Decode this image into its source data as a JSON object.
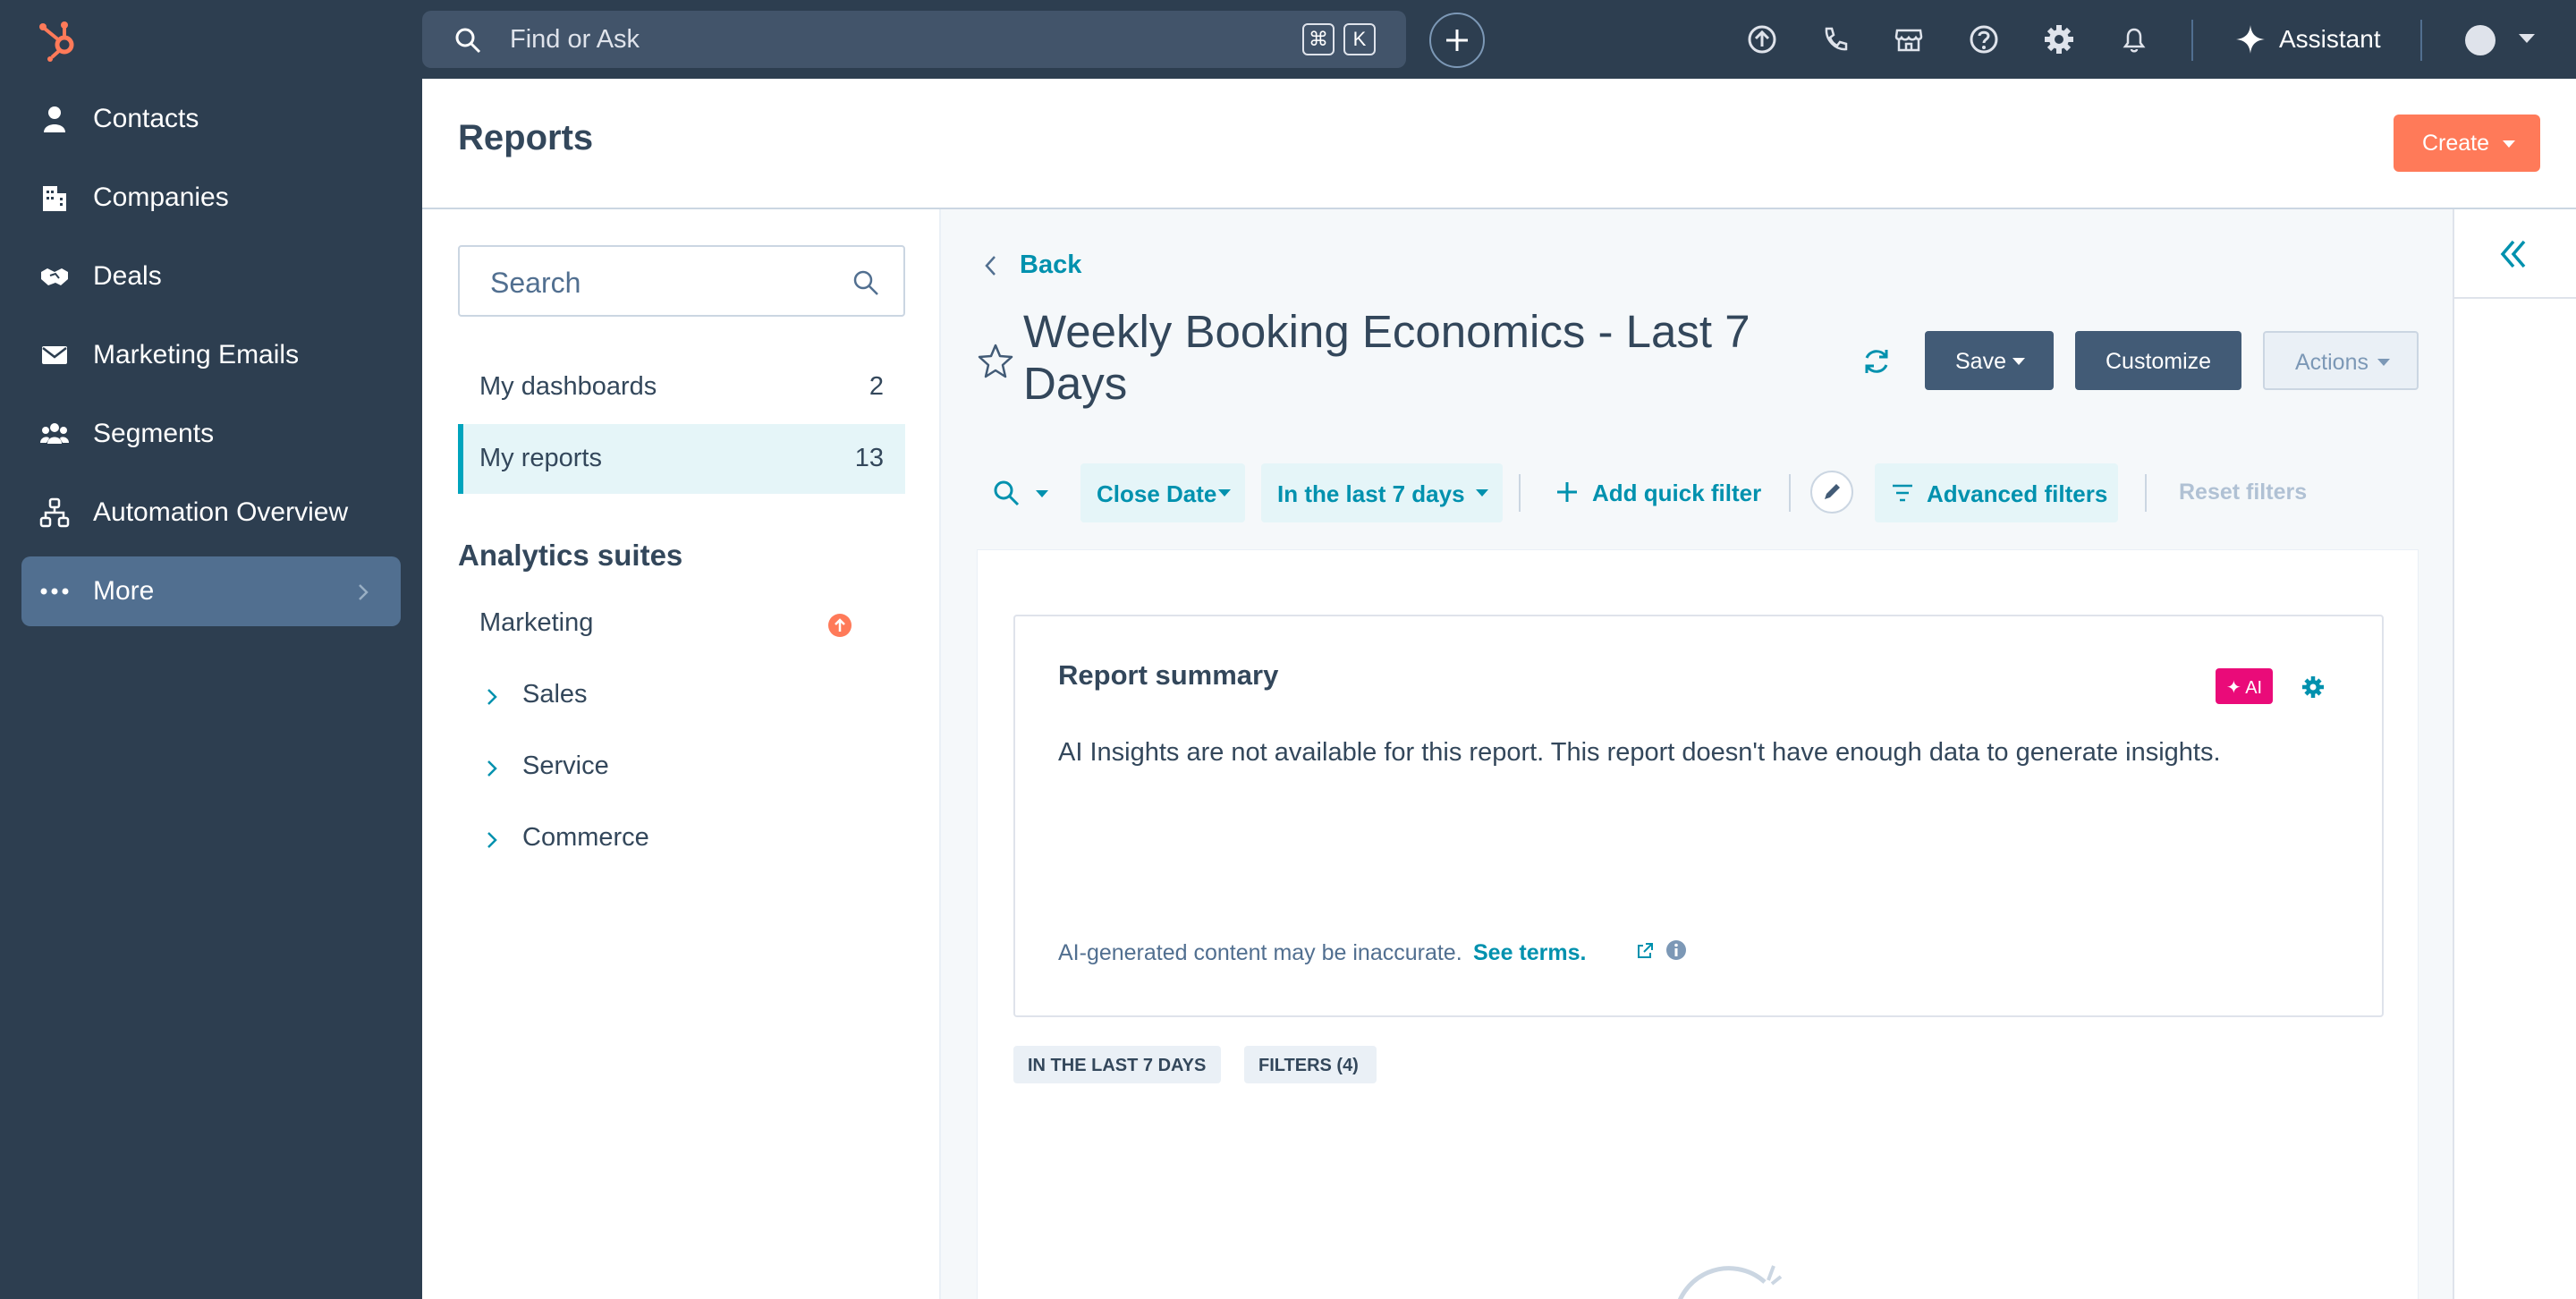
{
  "topnav": {
    "search_placeholder": "Find or Ask",
    "shortcut_keys": [
      "⌘",
      "K"
    ],
    "assistant_label": "Assistant"
  },
  "sidebar": {
    "items": [
      {
        "label": "Contacts",
        "icon": "contact-icon"
      },
      {
        "label": "Companies",
        "icon": "building-icon"
      },
      {
        "label": "Deals",
        "icon": "handshake-icon"
      },
      {
        "label": "Marketing Emails",
        "icon": "envelope-icon"
      },
      {
        "label": "Segments",
        "icon": "people-icon"
      },
      {
        "label": "Automation Overview",
        "icon": "workflow-icon"
      },
      {
        "label": "More",
        "icon": "more-dots-icon",
        "active": true
      }
    ]
  },
  "header": {
    "title": "Reports",
    "create_label": "Create"
  },
  "left_panel": {
    "search_placeholder": "Search",
    "nav": [
      {
        "label": "My dashboards",
        "count": "2"
      },
      {
        "label": "My reports",
        "count": "13",
        "active": true
      }
    ],
    "suites_title": "Analytics suites",
    "suites": [
      {
        "label": "Marketing",
        "expandable": false
      },
      {
        "label": "Sales",
        "expandable": true
      },
      {
        "label": "Service",
        "expandable": true
      },
      {
        "label": "Commerce",
        "expandable": true
      }
    ]
  },
  "main": {
    "back_label": "Back",
    "report_title": "Weekly Booking Economics - Last 7 Days",
    "save_label": "Save",
    "customize_label": "Customize",
    "actions_label": "Actions",
    "filters": {
      "close_date_label": "Close Date",
      "range_label": "In the last 7 days",
      "add_quick_filter_label": "Add quick filter",
      "advanced_filters_label": "Advanced filters",
      "reset_filters_label": "Reset filters"
    },
    "summary": {
      "title": "Report summary",
      "ai_badge": "✦ AI",
      "text": "AI Insights are not available for this report. This report doesn't have enough data to generate insights.",
      "disclaimer": "AI-generated content may be inaccurate.",
      "terms_link": "See terms."
    },
    "tags": [
      "IN THE LAST 7 DAYS",
      "FILTERS (4)"
    ]
  },
  "colors": {
    "nav_bg": "#2d3e50",
    "accent_orange": "#ff7a59",
    "link_teal": "#0091ae",
    "ai_pink": "#ea0b79",
    "button_dark": "#425b76"
  }
}
